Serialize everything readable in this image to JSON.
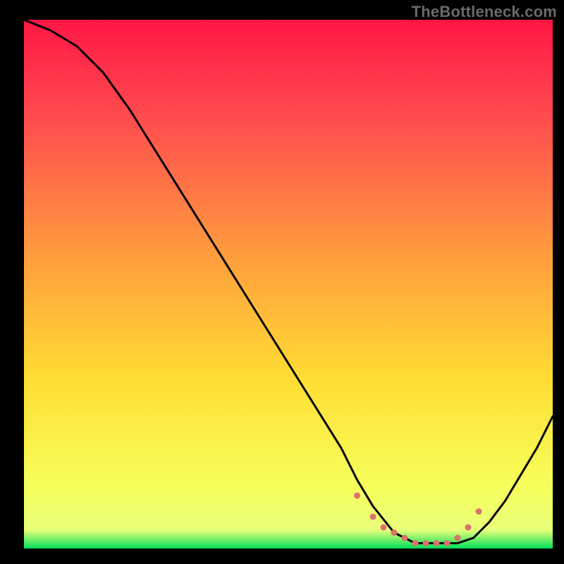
{
  "watermark": "TheBottleneck.com",
  "chart_data": {
    "type": "line",
    "title": "",
    "xlabel": "",
    "ylabel": "",
    "xlim": [
      0,
      100
    ],
    "ylim": [
      0,
      100
    ],
    "grid": false,
    "legend": false,
    "background_gradient": {
      "top_color": "#ff1744",
      "mid_color": "#ffdd33",
      "bottom_color": "#00e05a"
    },
    "series": [
      {
        "name": "bottleneck-curve",
        "color": "#000000",
        "x": [
          0,
          5,
          10,
          15,
          20,
          25,
          30,
          35,
          40,
          45,
          50,
          55,
          60,
          63,
          66,
          70,
          74,
          78,
          82,
          85,
          88,
          91,
          94,
          97,
          100
        ],
        "y": [
          100,
          98,
          95,
          90,
          83,
          75,
          67,
          59,
          51,
          43,
          35,
          27,
          19,
          13,
          8,
          3,
          1,
          1,
          1,
          2,
          5,
          9,
          14,
          19,
          25
        ]
      }
    ],
    "markers": {
      "name": "highlight-dots",
      "color": "#d9736b",
      "size": 9,
      "x": [
        63,
        66,
        68,
        70,
        72,
        74,
        76,
        78,
        80,
        82,
        84,
        86
      ],
      "y": [
        10,
        6,
        4,
        3,
        2,
        1,
        1,
        1,
        1,
        2,
        4,
        7
      ]
    }
  }
}
